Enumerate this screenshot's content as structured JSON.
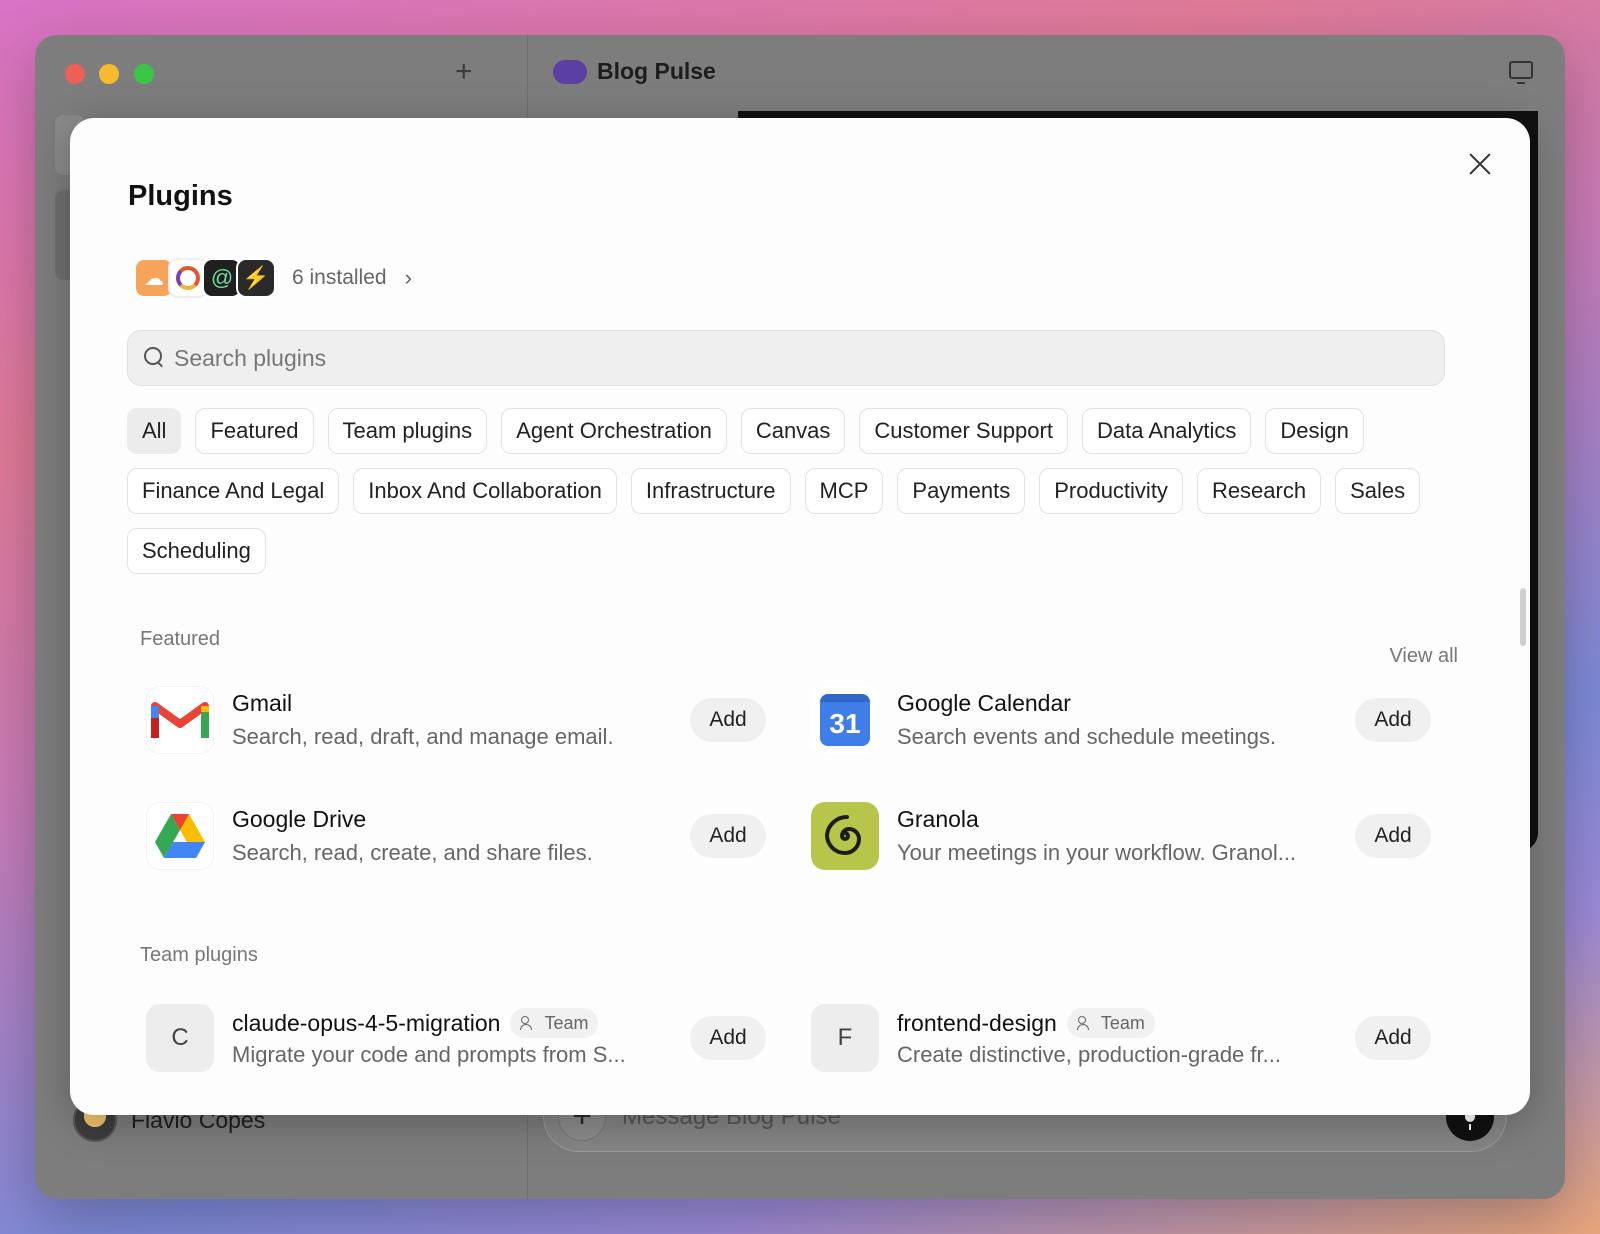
{
  "window": {
    "title": "Blog Pulse",
    "new_tab_symbol": "+",
    "user_name": "Flavio Copes",
    "composer_placeholder": "Message Blog Pulse",
    "composer_plus": "+"
  },
  "modal": {
    "title": "Plugins",
    "installed_label": "6 installed",
    "installed_icons": [
      "cloudflare-icon",
      "ring-logo-icon",
      "spiral-icon",
      "bolt-icon"
    ],
    "search_placeholder": "Search plugins",
    "categories": [
      {
        "label": "All",
        "active": true
      },
      {
        "label": "Featured",
        "active": false
      },
      {
        "label": "Team plugins",
        "active": false
      },
      {
        "label": "Agent Orchestration",
        "active": false
      },
      {
        "label": "Canvas",
        "active": false
      },
      {
        "label": "Customer Support",
        "active": false
      },
      {
        "label": "Data Analytics",
        "active": false
      },
      {
        "label": "Design",
        "active": false
      },
      {
        "label": "Finance And Legal",
        "active": false
      },
      {
        "label": "Inbox And Collaboration",
        "active": false
      },
      {
        "label": "Infrastructure",
        "active": false
      },
      {
        "label": "MCP",
        "active": false
      },
      {
        "label": "Payments",
        "active": false
      },
      {
        "label": "Productivity",
        "active": false
      },
      {
        "label": "Research",
        "active": false
      },
      {
        "label": "Sales",
        "active": false
      },
      {
        "label": "Scheduling",
        "active": false
      }
    ],
    "featured": {
      "label": "Featured",
      "view_all": "View all",
      "items": [
        {
          "name": "Gmail",
          "desc": "Search, read, draft, and manage email.",
          "action": "Add",
          "icon": "gmail-icon"
        },
        {
          "name": "Google Calendar",
          "desc": "Search events and schedule meetings.",
          "action": "Add",
          "icon": "google-calendar-icon",
          "icon_text": "31"
        },
        {
          "name": "Google Drive",
          "desc": "Search, read, create, and share files.",
          "action": "Add",
          "icon": "google-drive-icon"
        },
        {
          "name": "Granola",
          "desc": "Your meetings in your workflow. Granol...",
          "action": "Add",
          "icon": "granola-icon"
        }
      ]
    },
    "team": {
      "label": "Team plugins",
      "items": [
        {
          "name": "claude-opus-4-5-migration",
          "badge": "Team",
          "desc": "Migrate your code and prompts from S...",
          "action": "Add",
          "letter": "C"
        },
        {
          "name": "frontend-design",
          "badge": "Team",
          "desc": "Create distinctive, production-grade fr...",
          "action": "Add",
          "letter": "F"
        }
      ]
    }
  },
  "colors": {
    "granola": "#b7c64a",
    "calendar": "#3f7ee8",
    "title_pill": "#5b3fa3"
  }
}
